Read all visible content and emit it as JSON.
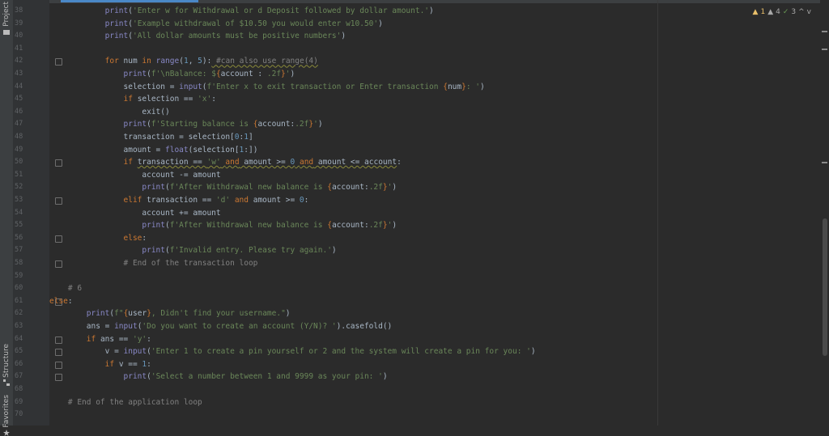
{
  "sidebar": {
    "project_label": "Project",
    "structure_label": "Structure",
    "favorites_label": "Favorites"
  },
  "inspections": {
    "warning_count": "1",
    "weak_warning_count": "4",
    "typo_count": "3",
    "up_arrow": "^",
    "down_arrow": "v"
  },
  "lines": [
    {
      "n": "38",
      "html": "            <span class=\"fn\">print</span>(<span class=\"str\">'Enter w for Withdrawal or d Deposit followed by dollar amount.'</span>)"
    },
    {
      "n": "39",
      "html": "            <span class=\"fn\">print</span>(<span class=\"str\">'Example withdrawal of $10.50 you would enter w10.50'</span>)"
    },
    {
      "n": "40",
      "html": "            <span class=\"fn\">print</span>(<span class=\"str\">'All dollar amounts must be positive numbers'</span>)"
    },
    {
      "n": "41",
      "html": ""
    },
    {
      "n": "42",
      "html": "            <span class=\"kw\">for</span> num <span class=\"kw\">in</span> <span class=\"fn\">range</span>(<span class=\"num\">1</span>, <span class=\"num\">5</span>):<span class=\"cm warn\"> #can also use range(4)</span>"
    },
    {
      "n": "43",
      "html": "                <span class=\"fn\">print</span>(<span class=\"str\">f'\\nBalance: $</span><span class=\"brace\">{</span>account : <span class=\"str\">.2f</span><span class=\"brace\">}</span><span class=\"str\">'</span>)"
    },
    {
      "n": "44",
      "html": "                selection = <span class=\"fn\">input</span>(<span class=\"str\">f'Enter x to exit transaction or Enter transaction </span><span class=\"brace\">{</span>num<span class=\"brace\">}</span><span class=\"str\">: '</span>)"
    },
    {
      "n": "45",
      "html": "                <span class=\"kw\">if</span> selection == <span class=\"str\">'x'</span>:"
    },
    {
      "n": "46",
      "html": "                    exit()"
    },
    {
      "n": "47",
      "html": "                <span class=\"fn\">print</span>(<span class=\"str\">f'Starting balance is </span><span class=\"brace\">{</span>account:<span class=\"str\">.2f</span><span class=\"brace\">}</span><span class=\"str\">'</span>)"
    },
    {
      "n": "48",
      "html": "                transaction = selection[<span class=\"num\">0</span>:<span class=\"num\">1</span>]"
    },
    {
      "n": "49",
      "html": "                amount = <span class=\"fn\">float</span>(selection[<span class=\"num\">1</span>:])"
    },
    {
      "n": "50",
      "html": "                <span class=\"kw\">if</span> <span class=\"warn\">transaction == <span class=\"str\">'w'</span> <span class=\"kw\">and</span> amount >= <span class=\"num\">0</span> <span class=\"kw\">and</span> amount <= account</span>:"
    },
    {
      "n": "51",
      "html": "                    account -= amount"
    },
    {
      "n": "52",
      "html": "                    <span class=\"fn\">print</span>(<span class=\"str\">f'After Withdrawal new balance is </span><span class=\"brace\">{</span>account:<span class=\"str\">.2f</span><span class=\"brace\">}</span><span class=\"str\">'</span>)"
    },
    {
      "n": "53",
      "html": "                <span class=\"kw\">elif</span> transaction == <span class=\"str\">'d'</span> <span class=\"kw\">and</span> amount >= <span class=\"num\">0</span>:"
    },
    {
      "n": "54",
      "html": "                    account += amount"
    },
    {
      "n": "55",
      "html": "                    <span class=\"fn\">print</span>(<span class=\"str\">f'After Withdrawal new balance is </span><span class=\"brace\">{</span>account:<span class=\"str\">.2f</span><span class=\"brace\">}</span><span class=\"str\">'</span>)"
    },
    {
      "n": "56",
      "html": "                <span class=\"kw\">else</span>:"
    },
    {
      "n": "57",
      "html": "                    <span class=\"fn\">print</span>(<span class=\"str\">f'Invalid entry. Please try again.'</span>)"
    },
    {
      "n": "58",
      "html": "                <span class=\"cm\"># End of the transaction loop</span>"
    },
    {
      "n": "59",
      "html": ""
    },
    {
      "n": "60",
      "html": "    <span class=\"cm\"># 6</span>"
    },
    {
      "n": "61",
      "html": "<span class=\"kw\">else</span>:"
    },
    {
      "n": "62",
      "html": "        <span class=\"fn\">print</span>(<span class=\"str\">f\"</span><span class=\"brace\">{</span>user<span class=\"brace\">}</span><span class=\"str\">, Didn't find your username.\"</span>)"
    },
    {
      "n": "63",
      "html": "        ans = <span class=\"fn\">input</span>(<span class=\"str\">'Do you want to create an account (Y/N)? '</span>).casefold()"
    },
    {
      "n": "64",
      "html": "        <span class=\"kw\">if</span> ans == <span class=\"str\">'y'</span>:"
    },
    {
      "n": "65",
      "html": "            v = <span class=\"fn\">input</span>(<span class=\"str\">'Enter 1 to create a pin yourself or 2 and the system will create a pin for you: '</span>)"
    },
    {
      "n": "66",
      "html": "            <span class=\"kw\">if</span> v == <span class=\"num\">1</span>:"
    },
    {
      "n": "67",
      "html": "                <span class=\"fn\">print</span>(<span class=\"str\">'Select a number between 1 and 9999 as your pin: '</span>)"
    },
    {
      "n": "68",
      "html": ""
    },
    {
      "n": "69",
      "html": "    <span class=\"cm\"># End of the application loop</span>"
    },
    {
      "n": "70",
      "html": ""
    }
  ]
}
